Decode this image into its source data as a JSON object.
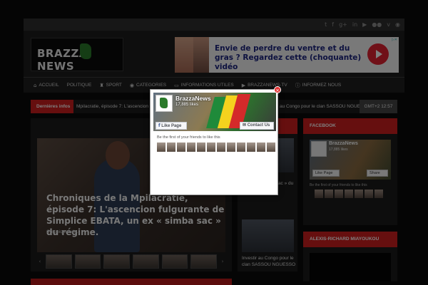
{
  "colors": {
    "accent": "#cc1f1f",
    "background": "#0b0b0b",
    "facebook": "#3b5998"
  },
  "topbar": {
    "social_icons": [
      "twitter-icon",
      "facebook-icon",
      "google-plus-icon",
      "linkedin-icon",
      "youtube-icon",
      "flickr-icon",
      "vimeo-icon",
      "rss-icon"
    ],
    "social_glyphs": [
      "t",
      "f",
      "g+",
      "in",
      "▶",
      "●●",
      "v",
      "◉"
    ]
  },
  "header": {
    "logo_text": "BRAZZA  NEWS",
    "ad": {
      "text": "Envie de perdre du ventre et du gras ? Regardez cette (choquante) vidéo"
    }
  },
  "nav": {
    "items": [
      {
        "label": "ACCUEIL",
        "icon": "home-icon",
        "glyph": "⌂"
      },
      {
        "label": "POLITIQUE",
        "icon": "",
        "glyph": ""
      },
      {
        "label": "SPORT",
        "icon": "trophy-icon",
        "glyph": "♜"
      },
      {
        "label": "CATEGORIES",
        "icon": "globe-icon",
        "glyph": "◉"
      },
      {
        "label": "INFORMATIONS UTILES",
        "icon": "folder-icon",
        "glyph": "▭"
      },
      {
        "label": "BRAZZANEWS-TV",
        "icon": "video-icon",
        "glyph": "▶"
      },
      {
        "label": "INFORMEZ NOUS",
        "icon": "info-icon",
        "glyph": "ⓘ"
      }
    ]
  },
  "ticker": {
    "label": "Dernières infos",
    "text": "Mpilacratie, épisode 7: L'ascencion fulgu",
    "text_right": "au Congo pour le clan SASSOU NGUE",
    "clock": "GMT+2 12:57"
  },
  "featured": {
    "title": "Chroniques de la Mpilacratie, épisode 7: L'ascencion fulgurante de Simplice EBATA, un ex « simba sac » du régime.",
    "category": "Chroniques de..."
  },
  "midcol": {
    "snippet1": "...un ex « simba sac » du régime.",
    "snippet2": "Investir au Congo pour le clan SASSOU NGUESSO"
  },
  "rightcol": {
    "facebook_header": "FACEBOOK",
    "page_name": "BrazzaNews",
    "likes": "17,885 likes",
    "like_label": "Like Page",
    "share_label": "Share",
    "friends_text": "Be the first of your friends to like this",
    "second_header": "ALEXIS-RICHARD MIAYOUKOU"
  },
  "modal": {
    "page_name": "BrazzaNews",
    "likes": "17,885 likes",
    "like_label": "Like Page",
    "contact_label": "Contact Us",
    "friends_text": "Be the first of your friends to like this",
    "close_glyph": "×"
  }
}
